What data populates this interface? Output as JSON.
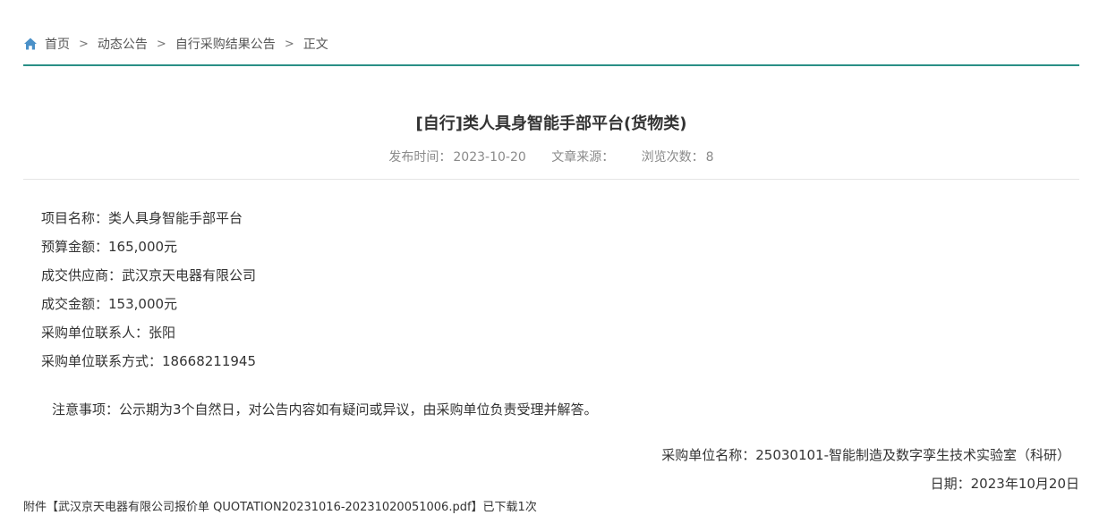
{
  "breadcrumb": {
    "home": "首页",
    "level1": "动态公告",
    "level2": "自行采购结果公告",
    "current": "正文",
    "separator": ">"
  },
  "article": {
    "title": "[自行]类人具身智能手部平台(货物类)",
    "meta": {
      "publish_label": "发布时间：",
      "publish_date": "2023-10-20",
      "source_label": "文章来源：",
      "source_value": "",
      "views_label": "浏览次数：",
      "views_value": "8"
    },
    "fields": [
      {
        "label": "项目名称：",
        "value": "类人具身智能手部平台"
      },
      {
        "label": "预算金额：",
        "value": "165,000元"
      },
      {
        "label": "成交供应商：",
        "value": "武汉京天电器有限公司"
      },
      {
        "label": "成交金额：",
        "value": "153,000元"
      },
      {
        "label": "采购单位联系人：",
        "value": "张阳"
      },
      {
        "label": "采购单位联系方式：",
        "value": "18668211945"
      }
    ],
    "notice": "注意事项：公示期为3个自然日，对公告内容如有疑问或异议，由采购单位负责受理并解答。",
    "signature": "采购单位名称：25030101-智能制造及数字孪生技术实验室（科研）",
    "date_line": "日期：2023年10月20日",
    "attachment": {
      "prefix": "附件",
      "link_text": "【武汉京天电器有限公司报价单 QUOTATION20231016-20231020051006.pdf】",
      "downloads": "已下载1次"
    }
  },
  "colors": {
    "accent": "#2a8f86",
    "home_icon": "#4a90c8"
  },
  "icons": {
    "home": "home-icon"
  }
}
